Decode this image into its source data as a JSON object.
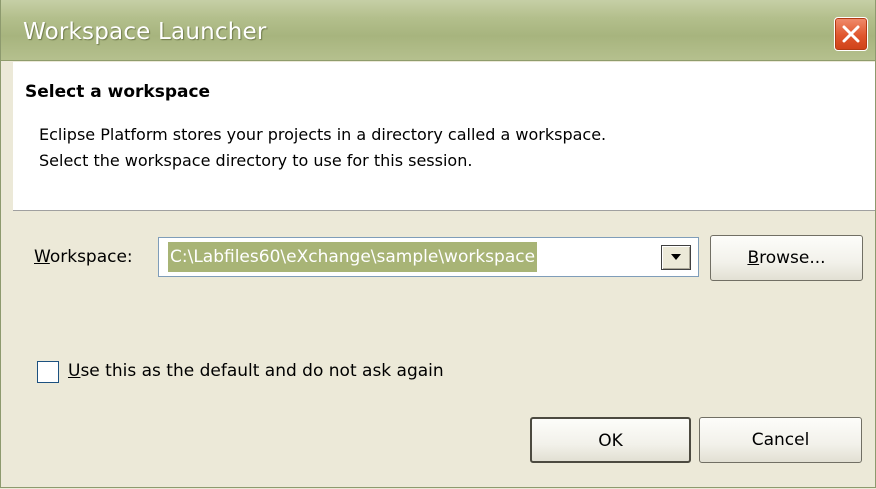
{
  "window": {
    "title": "Workspace Launcher"
  },
  "header": {
    "title": "Select a workspace",
    "description_line1": "Eclipse Platform stores your projects in a directory called a workspace.",
    "description_line2": "Select the workspace directory to use for this session."
  },
  "workspace": {
    "label_mnemonic": "W",
    "label_rest": "orkspace:",
    "value": "C:\\Labfiles60\\eXchange\\sample\\workspace",
    "browse_mnemonic": "B",
    "browse_rest": "rowse..."
  },
  "default_option": {
    "mnemonic": "U",
    "label_rest": "se this as the default and do not ask again",
    "checked": false
  },
  "buttons": {
    "ok": "OK",
    "cancel": "Cancel"
  },
  "icons": {
    "close": "close-icon",
    "dropdown": "chevron-down-icon"
  },
  "colors": {
    "title_bar": "#b3bf8c",
    "close_button": "#e0562d",
    "selection": "#a8b476",
    "dialog_bg": "#ece9d8"
  }
}
